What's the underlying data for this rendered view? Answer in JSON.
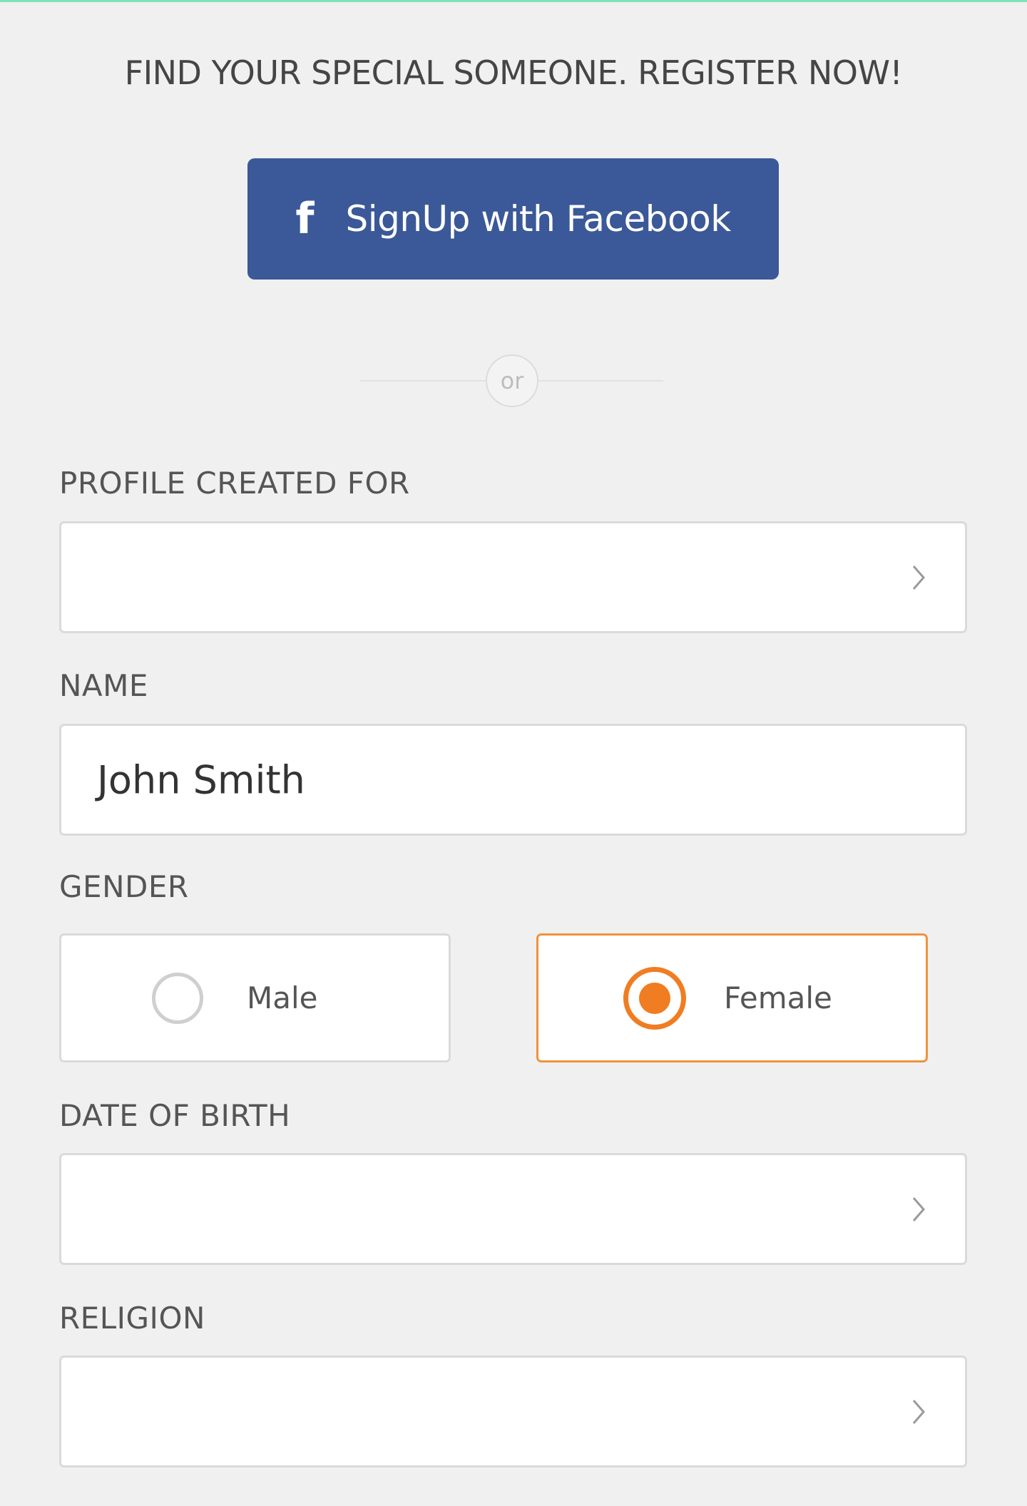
{
  "header": {
    "headline": "FIND YOUR SPECIAL SOMEONE. REGISTER NOW!"
  },
  "facebook_button": {
    "icon": "facebook-f-icon",
    "label": "SignUp with Facebook",
    "color": "#3b5998"
  },
  "divider": {
    "text": "or"
  },
  "form": {
    "profile_created_for": {
      "label": "PROFILE CREATED FOR",
      "value": "",
      "icon": "chevron-right-icon"
    },
    "name": {
      "label": "NAME",
      "value": "John Smith"
    },
    "gender": {
      "label": "GENDER",
      "options": [
        {
          "label": "Male",
          "selected": false
        },
        {
          "label": "Female",
          "selected": true
        }
      ],
      "accent_color": "#f07d22"
    },
    "date_of_birth": {
      "label": "DATE OF BIRTH",
      "value": "",
      "icon": "chevron-right-icon"
    },
    "religion": {
      "label": "RELIGION",
      "value": "",
      "icon": "chevron-right-icon"
    }
  }
}
